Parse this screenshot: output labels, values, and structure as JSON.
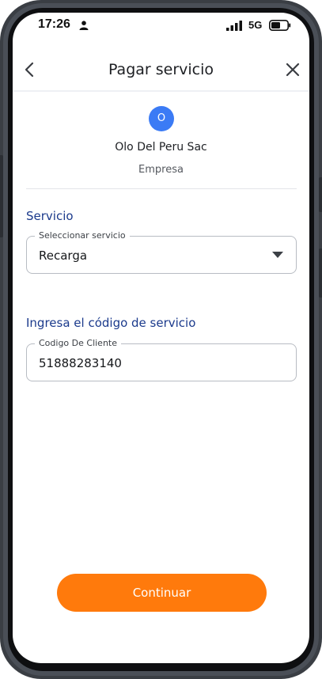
{
  "status_bar": {
    "time": "17:26",
    "network": "5G",
    "icons": [
      "person-icon",
      "signal-icon",
      "battery-icon"
    ]
  },
  "header": {
    "title": "Pagar servicio",
    "back_icon": "chevron-left-icon",
    "close_icon": "close-icon"
  },
  "company": {
    "initial": "O",
    "name": "Olo Del Peru Sac",
    "type": "Empresa",
    "avatar_color": "#3b7bf5"
  },
  "service": {
    "section_label": "Servicio",
    "select_legend": "Seleccionar servicio",
    "selected_value": "Recarga"
  },
  "code": {
    "section_label": "Ingresa el código de servicio",
    "input_legend": "Codigo De Cliente",
    "value": "51888283140"
  },
  "actions": {
    "continue_label": "Continuar",
    "accent_color": "#ff7a0c"
  }
}
